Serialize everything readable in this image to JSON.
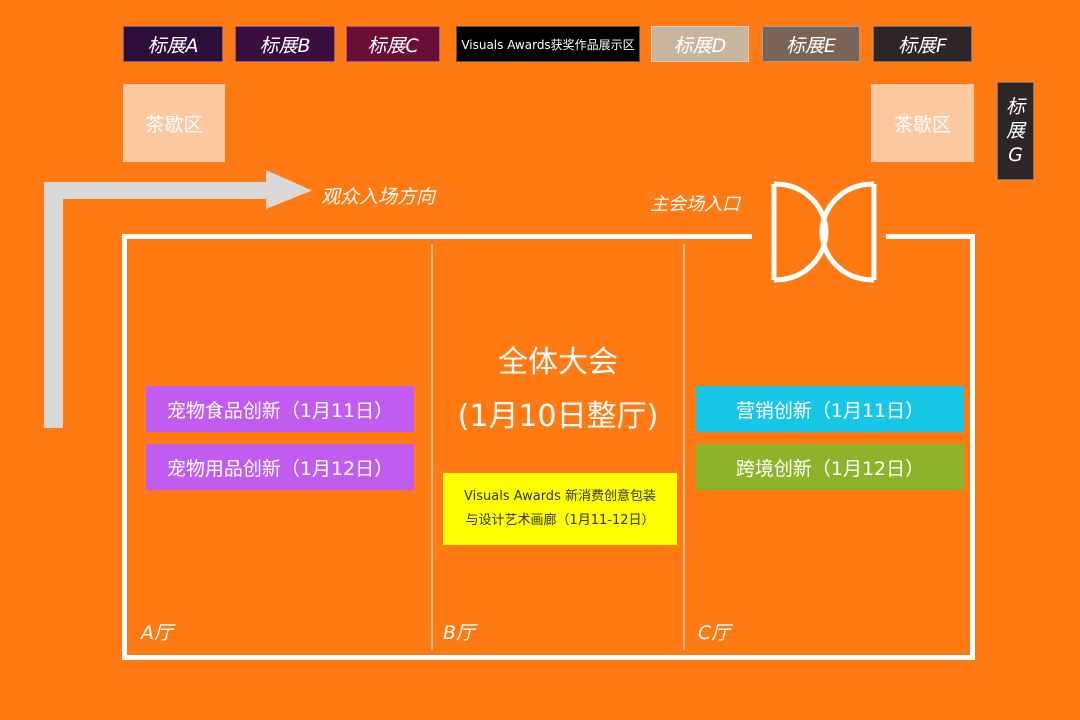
{
  "booths": [
    {
      "label": "标展A",
      "bg": "#2E0E3A"
    },
    {
      "label": "标展B",
      "bg": "#3A0E40"
    },
    {
      "label": "标展C",
      "bg": "#6A0E35"
    },
    {
      "label": "Visuals Awards获奖作品展示区",
      "bg": "#000000"
    },
    {
      "label": "标展D",
      "bg": "#C9B49E"
    },
    {
      "label": "标展E",
      "bg": "#7A6457"
    },
    {
      "label": "标展F",
      "bg": "#2E2626"
    }
  ],
  "booth_g": {
    "line1": "标",
    "line2": "展",
    "line3": "G"
  },
  "tea_left": "茶歇区",
  "tea_right": "茶歇区",
  "audience_direction": "观众入场方向",
  "main_entrance": "主会场入口",
  "halls": {
    "a": {
      "name": "A厅",
      "sessions": [
        {
          "label": "宠物食品创新（1月11日）",
          "color": "#C15CF0"
        },
        {
          "label": "宠物用品创新（1月12日）",
          "color": "#C15CF0"
        }
      ]
    },
    "b": {
      "name": "B厅",
      "title_line1": "全体大会",
      "title_line2": "(1月10日整厅)",
      "gallery_line1": "Visuals Awards 新消费创意包装",
      "gallery_line2": "与设计艺术画廊（1月11-12日）",
      "gallery_color": "#FFFF00"
    },
    "c": {
      "name": "C厅",
      "sessions": [
        {
          "label": "营销创新（1月11日）",
          "color": "#18C6E8"
        },
        {
          "label": "跨境创新（1月12日）",
          "color": "#8DB32A"
        }
      ]
    }
  }
}
